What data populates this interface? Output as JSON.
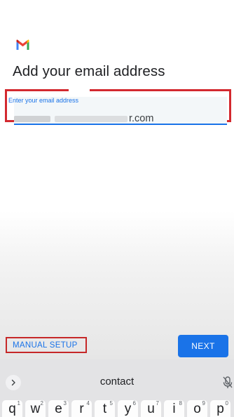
{
  "header": {
    "logo_icon": "gmail-logo-icon",
    "title": "Add your email address"
  },
  "email_input": {
    "label": "Enter your email address",
    "value_visible_suffix": "r.com"
  },
  "actions": {
    "manual_setup_label": "MANUAL SETUP",
    "next_label": "NEXT"
  },
  "keyboard": {
    "expand_icon": "chevron-right-icon",
    "suggestion": "contact",
    "mic_icon": "mic-off-icon",
    "keys": [
      {
        "letter": "q",
        "num": "1"
      },
      {
        "letter": "w",
        "num": "2"
      },
      {
        "letter": "e",
        "num": "3"
      },
      {
        "letter": "r",
        "num": "4"
      },
      {
        "letter": "t",
        "num": "5"
      },
      {
        "letter": "y",
        "num": "6"
      },
      {
        "letter": "u",
        "num": "7"
      },
      {
        "letter": "i",
        "num": "8"
      },
      {
        "letter": "o",
        "num": "9"
      },
      {
        "letter": "p",
        "num": "0"
      }
    ]
  },
  "colors": {
    "accent_blue": "#1a73e8",
    "highlight_red": "#d3292f"
  }
}
